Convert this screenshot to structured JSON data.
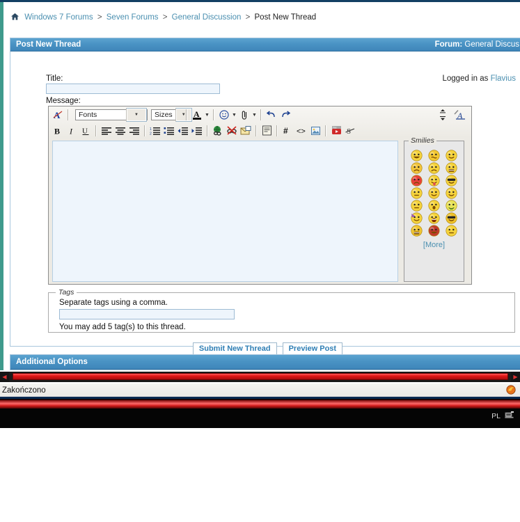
{
  "breadcrumb": {
    "home_icon": "home-icon",
    "items": [
      {
        "label": "Windows 7 Forums",
        "link": true
      },
      {
        "label": "Seven Forums",
        "link": true
      },
      {
        "label": "General Discussion",
        "link": true
      },
      {
        "label": "Post New Thread",
        "link": false
      }
    ],
    "separator": ">"
  },
  "header": {
    "title": "Post New Thread",
    "forum_label": "Forum:",
    "forum_name": "General Discus"
  },
  "form": {
    "title_label": "Title:",
    "title_value": "",
    "message_label": "Message:",
    "logged_in_prefix": "Logged in as",
    "logged_in_user": "Flavius",
    "message_value": ""
  },
  "toolbar": {
    "row1": [
      {
        "name": "remove-formatting-icon",
        "label": "A"
      },
      {
        "name": "font-family-select",
        "label": "Fonts"
      },
      {
        "name": "font-size-select",
        "label": "Sizes"
      },
      {
        "name": "font-color-icon",
        "label": "A"
      },
      {
        "name": "smilie-icon",
        "label": "☺"
      },
      {
        "name": "attachment-icon",
        "label": "0"
      },
      {
        "name": "undo-icon",
        "label": "↶"
      },
      {
        "name": "redo-icon",
        "label": "↷"
      }
    ],
    "fonts_label": "Fonts",
    "sizes_label": "Sizes",
    "resize_icon": "resize-editor-icon",
    "wysiwyg_icon": "toggle-wysiwyg-icon",
    "row2": [
      {
        "name": "bold-button",
        "label": "B"
      },
      {
        "name": "italic-button",
        "label": "I"
      },
      {
        "name": "underline-button",
        "label": "U"
      },
      {
        "name": "align-left-button",
        "label": ""
      },
      {
        "name": "align-center-button",
        "label": ""
      },
      {
        "name": "align-right-button",
        "label": ""
      },
      {
        "name": "ordered-list-button",
        "label": ""
      },
      {
        "name": "unordered-list-button",
        "label": ""
      },
      {
        "name": "outdent-button",
        "label": ""
      },
      {
        "name": "indent-button",
        "label": ""
      },
      {
        "name": "insert-link-button",
        "label": ""
      },
      {
        "name": "remove-link-button",
        "label": ""
      },
      {
        "name": "insert-email-button",
        "label": ""
      },
      {
        "name": "insert-quote-button",
        "label": ""
      },
      {
        "name": "insert-code-hash-button",
        "label": "#"
      },
      {
        "name": "insert-html-code-button",
        "label": "<>"
      },
      {
        "name": "insert-image-button",
        "label": ""
      },
      {
        "name": "insert-video-button",
        "label": ""
      },
      {
        "name": "strikethrough-button",
        "label": "S"
      }
    ]
  },
  "smilies": {
    "legend": "Smilies",
    "more_label": "[More]",
    "items": [
      {
        "name": "smilie-big-grin",
        "face": "#f5d33c",
        "mouth": "grin"
      },
      {
        "name": "smilie-confused",
        "face": "#f3c832",
        "mouth": "wavy"
      },
      {
        "name": "smilie-smile",
        "face": "#f5d33c",
        "mouth": "smile"
      },
      {
        "name": "smilie-cry",
        "face": "#f2c43c",
        "mouth": "frown"
      },
      {
        "name": "smilie-frown",
        "face": "#f5d33c",
        "mouth": "frown"
      },
      {
        "name": "smilie-eek",
        "face": "#f5d33c",
        "mouth": "teeth"
      },
      {
        "name": "smilie-mad",
        "face": "#e8403a",
        "mouth": "frown"
      },
      {
        "name": "smilie-tongue",
        "face": "#f5d33c",
        "mouth": "tongue"
      },
      {
        "name": "smilie-cool",
        "face": "#f5d33c",
        "mouth": "smile"
      },
      {
        "name": "smilie-rolleyes",
        "face": "#f5d33c",
        "mouth": "flat"
      },
      {
        "name": "smilie-blush",
        "face": "#f5cf3c",
        "mouth": "smile"
      },
      {
        "name": "smilie-wink",
        "face": "#f5d33c",
        "mouth": "smile"
      },
      {
        "name": "smilie-arrow",
        "face": "#f5d33c",
        "mouth": "flat"
      },
      {
        "name": "smilie-surprised",
        "face": "#f5d33c",
        "mouth": "o"
      },
      {
        "name": "smilie-sick",
        "face": "#e8e45a",
        "mouth": "sick"
      },
      {
        "name": "smilie-party",
        "face": "#f5d33c",
        "mouth": "party"
      },
      {
        "name": "smilie-laugh",
        "face": "#f5d33c",
        "mouth": "open"
      },
      {
        "name": "smilie-sunglasses",
        "face": "#f0c22a",
        "mouth": "smile"
      },
      {
        "name": "smilie-shock",
        "face": "#f0c633",
        "mouth": "teeth"
      },
      {
        "name": "smilie-devil",
        "face": "#c0392b",
        "mouth": "grin"
      },
      {
        "name": "smilie-think",
        "face": "#f5d33c",
        "mouth": "flat"
      }
    ]
  },
  "tags": {
    "legend": "Tags",
    "instruction": "Separate tags using a comma.",
    "value": "",
    "note": "You may add 5 tag(s) to this thread."
  },
  "actions": {
    "submit_label": "Submit New Thread",
    "preview_label": "Preview Post"
  },
  "additional_options": {
    "title": "Additional Options"
  },
  "statusbar": {
    "text": "Zakończono",
    "icon": "firefox-icon"
  },
  "taskbar": {
    "language": "PL",
    "tray_icon": "network-tray-icon"
  },
  "colors": {
    "header_blue": "#4a93c4",
    "link_blue": "#4a8fb0",
    "field_bg": "#eef5fc",
    "accent_teal": "#3f9a8c",
    "scrollbar_red": "#e11818"
  }
}
